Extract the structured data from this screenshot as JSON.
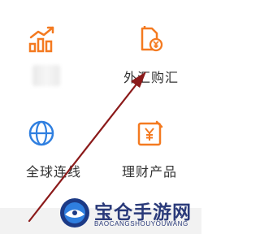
{
  "grid": {
    "items": [
      {
        "label": "",
        "icon": "bar-chart-icon"
      },
      {
        "label": "外汇购汇",
        "icon": "document-yuan-icon"
      },
      {
        "label": "全球连线",
        "icon": "globe-icon"
      },
      {
        "label": "理财产品",
        "icon": "wealth-product-icon"
      }
    ]
  },
  "watermark": {
    "cn": "宝仓手游网",
    "en": "BAOCANGSHOUYOUWANG"
  },
  "colors": {
    "icon_orange": "#f47a20",
    "icon_blue": "#2f7fe0",
    "label_text": "#333333",
    "arrow": "#8b1a1a",
    "watermark": "#2a3a7a"
  }
}
